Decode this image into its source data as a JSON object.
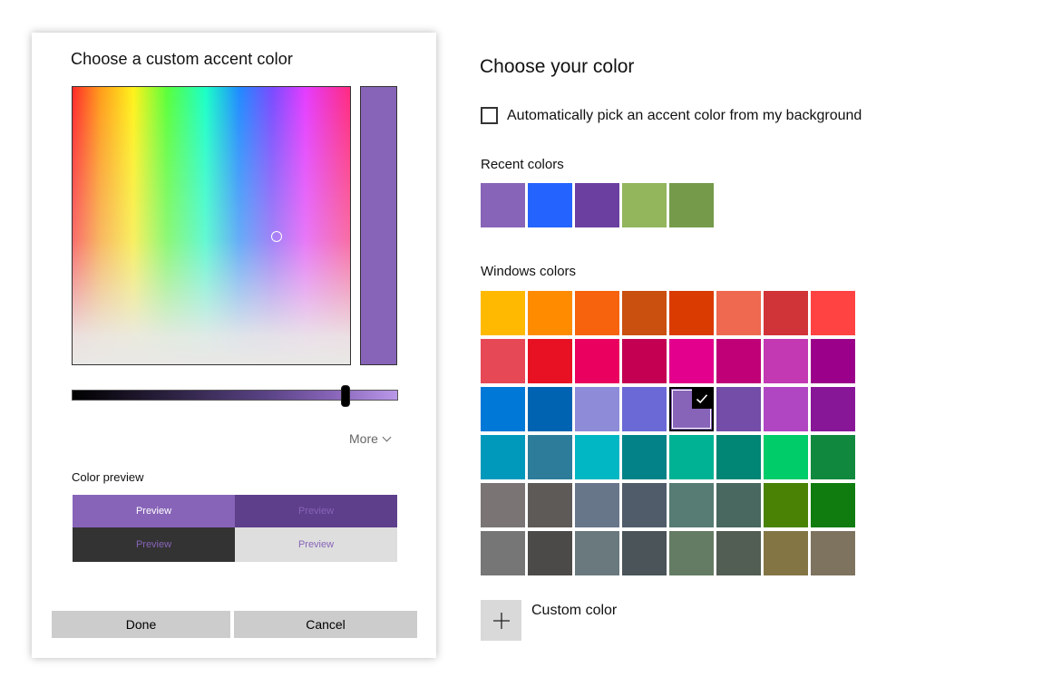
{
  "dialog": {
    "title": "Choose a custom accent color",
    "selected_color": "#8764B8",
    "more_label": "More",
    "preview_label": "Color preview",
    "preview_cells": [
      "Preview",
      "Preview",
      "Preview",
      "Preview"
    ],
    "done_label": "Done",
    "cancel_label": "Cancel"
  },
  "main": {
    "title": "Choose your color",
    "auto_pick_label": "Automatically pick an accent color from my background",
    "auto_pick_checked": false,
    "recent_label": "Recent colors",
    "recent_colors": [
      "#8764B8",
      "#2563FF",
      "#6B3FA0",
      "#93B55C",
      "#759B4A"
    ],
    "windows_label": "Windows colors",
    "windows_colors": [
      [
        "#FFB900",
        "#FF8C00",
        "#F7630C",
        "#CA5010",
        "#DA3B01",
        "#EF6950",
        "#D13438",
        "#FF4343"
      ],
      [
        "#E74856",
        "#E81123",
        "#EA005E",
        "#C30052",
        "#E3008C",
        "#BF0077",
        "#C239B3",
        "#9A0089"
      ],
      [
        "#0078D7",
        "#0063B1",
        "#8E8CD8",
        "#6B69D6",
        "#8764B8",
        "#744DA9",
        "#B146C2",
        "#881798"
      ],
      [
        "#0099BC",
        "#2D7D9A",
        "#00B7C3",
        "#038387",
        "#00B294",
        "#018574",
        "#00CC6A",
        "#10893E"
      ],
      [
        "#7A7574",
        "#5D5A58",
        "#68768A",
        "#515C6B",
        "#567C73",
        "#486860",
        "#498205",
        "#107C10"
      ],
      [
        "#767676",
        "#4C4A48",
        "#69797E",
        "#4A5459",
        "#647C64",
        "#525E54",
        "#847545",
        "#7E735F"
      ]
    ],
    "selected_windows_color": "#8764B8",
    "custom_label": "Custom color"
  }
}
